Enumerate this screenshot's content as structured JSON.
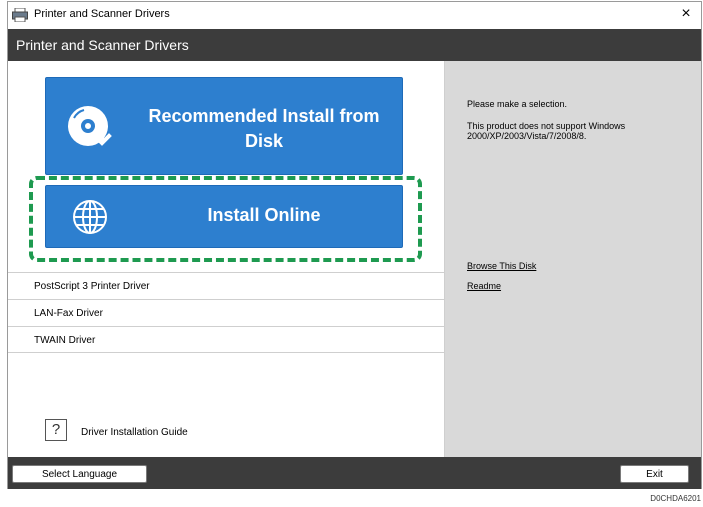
{
  "window": {
    "title": "Printer and Scanner Drivers",
    "close_glyph": "×"
  },
  "header": {
    "title": "Printer and Scanner Drivers"
  },
  "buttons": {
    "recommended_line1": "Recommended Install from",
    "recommended_line2": "Disk",
    "install_online": "Install Online"
  },
  "list": {
    "items": [
      "PostScript 3 Printer Driver",
      "LAN-Fax Driver",
      "TWAIN Driver"
    ]
  },
  "help": {
    "icon_glyph": "?",
    "label": "Driver Installation Guide"
  },
  "info": {
    "prompt": "Please make a selection.",
    "notice_line1": "This product does not support Windows",
    "notice_line2": "2000/XP/2003/Vista/7/2008/8."
  },
  "links": {
    "browse": "Browse This Disk",
    "readme": "Readme"
  },
  "footer": {
    "select_language": "Select Language",
    "exit": "Exit"
  },
  "figure_code": "D0CHDA6201",
  "colors": {
    "button_blue": "#2d7fcf",
    "highlight_green": "#1e9a50",
    "bar_dark": "#3c3c3c",
    "panel_gray": "#d9d9d9"
  }
}
